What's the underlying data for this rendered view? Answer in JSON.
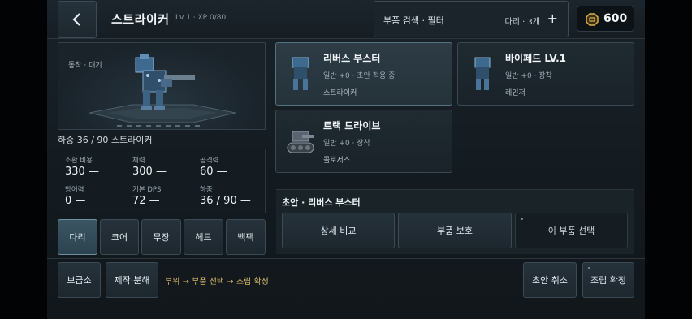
{
  "header": {
    "title": "스트라이커",
    "level": "Lv 1 · XP 0/80",
    "search_label": "부품 검색 · 필터",
    "filter_summary": "다리 · 3개",
    "add_symbol": "+",
    "currency_value": "600",
    "currency_icon": "gear-coin-icon"
  },
  "preview": {
    "state_label": "동작 · 대기",
    "weight_line": "하중 36 / 90 스트라이커"
  },
  "stats": [
    {
      "label": "소환 비용",
      "value": "330 —"
    },
    {
      "label": "체력",
      "value": "300 —"
    },
    {
      "label": "공격력",
      "value": "60 —"
    },
    {
      "label": "방어력",
      "value": "0 —"
    },
    {
      "label": "기본 DPS",
      "value": "72 —"
    },
    {
      "label": "하중",
      "value": "36 / 90 —"
    }
  ],
  "tabs": [
    {
      "label": "다리",
      "active": true
    },
    {
      "label": "코어",
      "active": false
    },
    {
      "label": "무장",
      "active": false
    },
    {
      "label": "헤드",
      "active": false
    },
    {
      "label": "백팩",
      "active": false
    }
  ],
  "parts": [
    {
      "title": "리버스 부스터",
      "sub": "일반 +0 · 초안 적용 중",
      "owner": "스트라이커",
      "selected": true
    },
    {
      "title": "바이페드 LV.1",
      "sub": "일반 +0 · 장착",
      "owner": "레인저",
      "selected": false
    },
    {
      "title": "트랙 드라이브",
      "sub": "일반 +0 · 장착",
      "owner": "콜로서스",
      "selected": false
    }
  ],
  "detail": {
    "title": "초안 · 리버스 부스터",
    "compare_label": "상세 비교",
    "protect_label": "부품 보호",
    "select_label": "이 부품 선택"
  },
  "footer": {
    "depot_label": "보급소",
    "craft_label": "제작·분해",
    "hint": "부위 → 부품 선택 → 조립 확정",
    "cancel_label": "초안 취소",
    "confirm_label": "조립 확정"
  },
  "colors": {
    "accent": "#6f90a2",
    "hint": "#d6b86a",
    "coin": "#d9b24a"
  }
}
